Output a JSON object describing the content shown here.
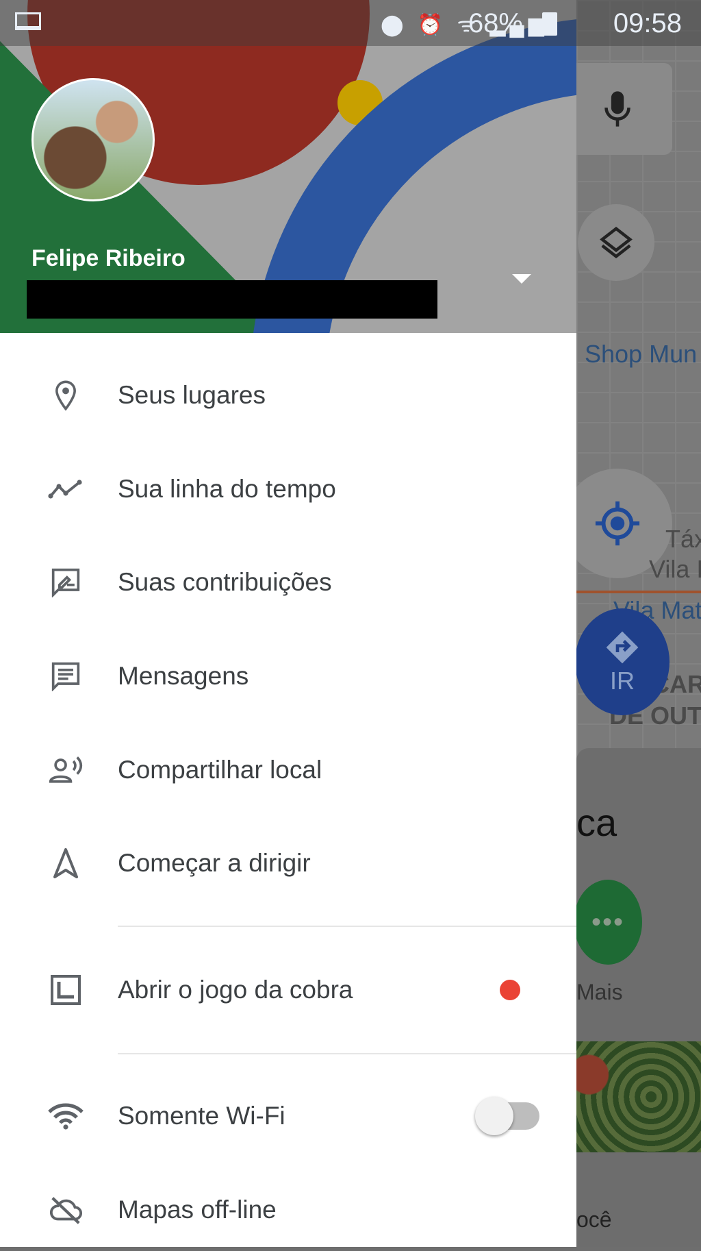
{
  "status_bar": {
    "battery": "68%",
    "time": "09:58",
    "icons": [
      "laptop-icon",
      "location-icon",
      "alarm-icon",
      "volte-icon",
      "wifi-icon",
      "signal-icon",
      "battery-icon"
    ]
  },
  "account": {
    "name": "Felipe Ribeiro"
  },
  "menu": [
    {
      "label": "Seus lugares",
      "icon": "pin-icon"
    },
    {
      "label": "Sua linha do tempo",
      "icon": "timeline-icon"
    },
    {
      "label": "Suas contribuições",
      "icon": "contributions-icon"
    },
    {
      "label": "Mensagens",
      "icon": "messages-icon"
    },
    {
      "label": "Compartilhar local",
      "icon": "share-location-icon"
    },
    {
      "label": "Começar a dirigir",
      "icon": "navigation-icon"
    },
    {
      "label": "Abrir o jogo da cobra",
      "icon": "snake-game-icon"
    },
    {
      "label": "Somente Wi-Fi",
      "icon": "wifi-icon"
    },
    {
      "label": "Mapas off-line",
      "icon": "offline-maps-icon"
    }
  ],
  "wifi_only_enabled": false,
  "map": {
    "labels": [
      "Shop Mun",
      "Táx",
      "Vila I",
      "Vila Mat",
      "CAR",
      "DE OUT"
    ],
    "go_label": "IR",
    "sheet_text": "ca",
    "more_label": "Mais",
    "bottom_text": "ocê"
  },
  "colors": {
    "accent": "#1a73e8",
    "go_button": "#1f3f8a",
    "more_button": "#1e6a34",
    "badge": "#ea4335"
  }
}
